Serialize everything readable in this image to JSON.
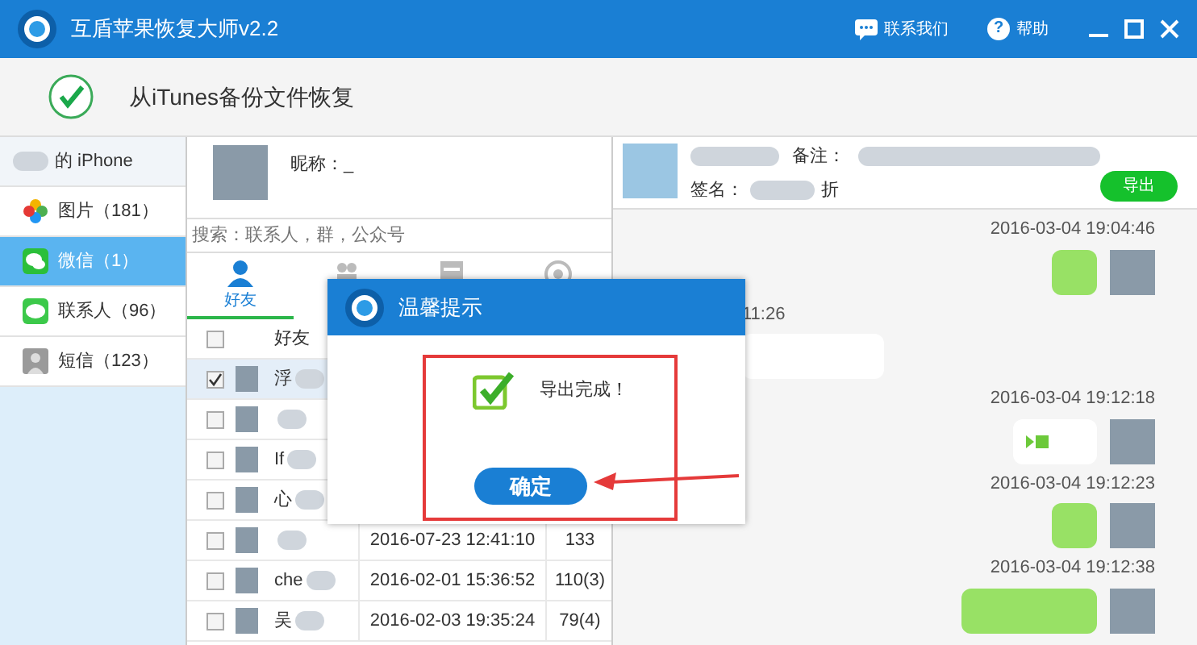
{
  "window": {
    "title": "互盾苹果恢复大师v2.2",
    "header_links": [
      {
        "kind": "chat",
        "label": "联系我们"
      },
      {
        "kind": "help",
        "icon": "?",
        "label": "帮助"
      }
    ]
  },
  "subheader": {
    "title": "从iTunes备份文件恢复"
  },
  "sidebar": {
    "device": "的 iPhone",
    "items": [
      {
        "kind": "photos",
        "label": "图片（181）",
        "selected": false
      },
      {
        "kind": "wechat",
        "label": "微信（1）",
        "selected": true
      },
      {
        "kind": "contacts",
        "label": "联系人（96）",
        "selected": false
      },
      {
        "kind": "sms",
        "label": "短信（123）",
        "selected": false
      }
    ]
  },
  "profile": {
    "nickname": "昵称：_"
  },
  "search": {
    "placeholder": "搜索：联系人，群，公众号"
  },
  "tabs": [
    {
      "kind": "friends",
      "label": "好友",
      "selected": true
    },
    {
      "kind": "groups",
      "selected": false
    },
    {
      "kind": "accounts",
      "selected": false
    },
    {
      "kind": "other",
      "selected": false
    }
  ],
  "friends_table": {
    "header": "好友",
    "select_all": false,
    "rows": [
      {
        "name": "浮",
        "time": "",
        "count": "",
        "checked": true
      },
      {
        "name": "",
        "time": "",
        "count": "",
        "checked": false
      },
      {
        "name": "If",
        "time": "",
        "count": "",
        "checked": false
      },
      {
        "name": "心",
        "time": "",
        "count": "",
        "checked": false
      },
      {
        "name": "",
        "time": "2016-07-23 12:41:10",
        "count": "133",
        "checked": false
      },
      {
        "name": "che",
        "time": "2016-02-01 15:36:52",
        "count": "110(3)",
        "checked": false
      },
      {
        "name": "吴",
        "time": "2016-02-03 19:35:24",
        "count": "79(4)",
        "checked": false
      }
    ]
  },
  "chat": {
    "remark_label": "备注：",
    "signature_label": "签名：",
    "signature_fragment": "折",
    "export_button": "导出",
    "messages": [
      {
        "kind": "time",
        "text": "2016-03-04 19:04:46"
      },
      {
        "kind": "out"
      },
      {
        "kind": "time-in",
        "text": "11:26"
      },
      {
        "kind": "in"
      },
      {
        "kind": "time",
        "text": "2016-03-04 19:12:18"
      },
      {
        "kind": "voice"
      },
      {
        "kind": "time",
        "text": "2016-03-04 19:12:23"
      },
      {
        "kind": "out"
      },
      {
        "kind": "time",
        "text": "2016-03-04 19:12:38"
      },
      {
        "kind": "out-wide"
      }
    ]
  },
  "dialog": {
    "title": "温馨提示",
    "message": "导出完成！",
    "button": "确定"
  }
}
